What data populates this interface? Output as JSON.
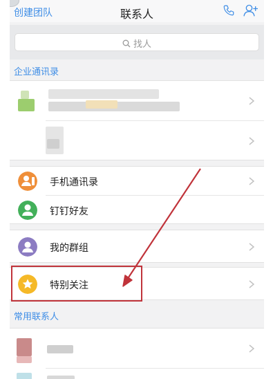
{
  "navbar": {
    "left_label": "创建团队",
    "title": "联系人",
    "phone_icon": "phone-icon",
    "add_user_icon": "add-user-icon"
  },
  "search": {
    "placeholder": "找人"
  },
  "sections": {
    "enterprise": "企业通讯录",
    "frequent": "常用联系人"
  },
  "menu": {
    "phone_contacts": "手机通讯录",
    "dingtalk_friends": "钉钉好友",
    "my_groups": "我的群组",
    "special_follow": "特别关注"
  },
  "colors": {
    "accent": "#3e8de6",
    "phone_contacts_icon": "#ef8f3a",
    "friends_icon": "#43b05a",
    "groups_icon": "#8c7cc2",
    "special_icon": "#f5b928",
    "annotation": "#c0333a"
  }
}
